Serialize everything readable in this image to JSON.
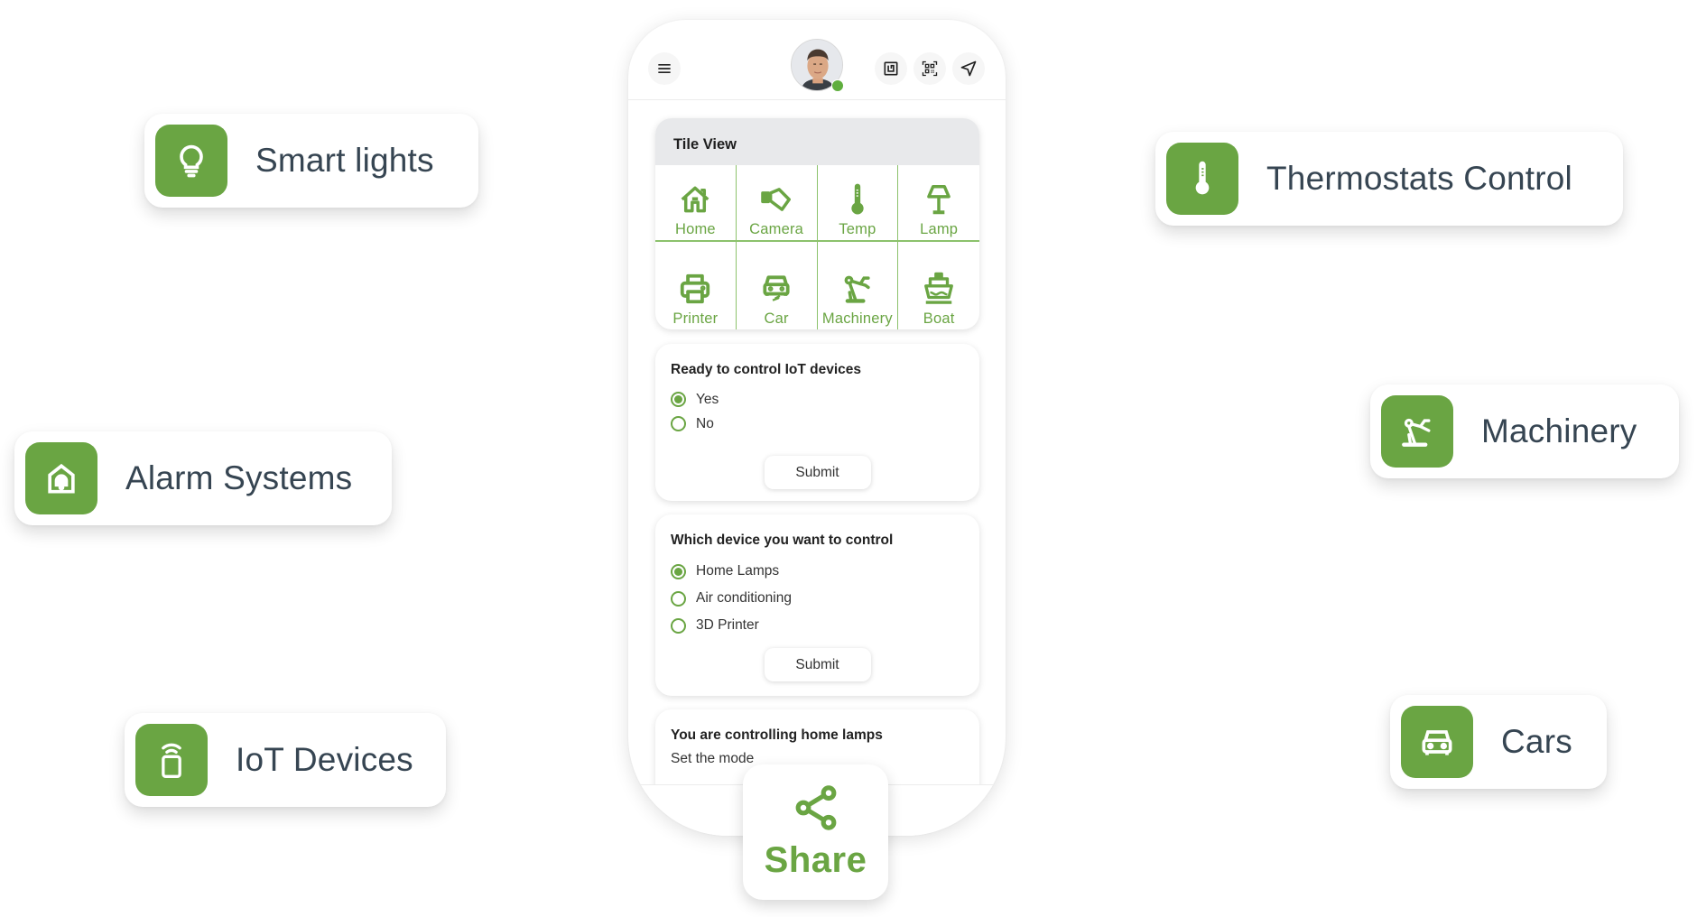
{
  "theme": {
    "accent": "#6aa543",
    "label_color": "#364552",
    "online": "#5fae3e"
  },
  "features": [
    {
      "label": "Smart lights",
      "icon": "lightbulb-icon"
    },
    {
      "label": "Thermostats Control",
      "icon": "thermometer-icon"
    },
    {
      "label": "Alarm Systems",
      "icon": "home-alarm-icon"
    },
    {
      "label": "IoT Devices",
      "icon": "remote-signal-icon"
    },
    {
      "label": "Machinery",
      "icon": "robot-arm-icon"
    },
    {
      "label": "Cars",
      "icon": "car-icon"
    }
  ],
  "header": {
    "menu_icon": "hamburger-menu-icon",
    "avatar": "user-avatar",
    "status": "online",
    "actions": [
      "nfc-icon",
      "qr-code-icon",
      "send-icon"
    ]
  },
  "tile_view": {
    "title": "Tile View",
    "tiles": [
      {
        "label": "Home",
        "icon": "home-icon"
      },
      {
        "label": "Camera",
        "icon": "camera-icon"
      },
      {
        "label": "Temp",
        "icon": "thermometer-icon"
      },
      {
        "label": "Lamp",
        "icon": "lamp-icon"
      },
      {
        "label": "Printer",
        "icon": "printer-icon"
      },
      {
        "label": "Car",
        "icon": "electric-car-icon"
      },
      {
        "label": "Machinery",
        "icon": "robot-arm-icon"
      },
      {
        "label": "Boat",
        "icon": "boat-icon"
      }
    ]
  },
  "question1": {
    "title": "Ready to control IoT devices",
    "options": [
      {
        "label": "Yes",
        "selected": true
      },
      {
        "label": "No",
        "selected": false
      }
    ],
    "submit_label": "Submit"
  },
  "question2": {
    "title": "Which device you want to control",
    "options": [
      {
        "label": "Home Lamps",
        "selected": true
      },
      {
        "label": "Air conditioning",
        "selected": false
      },
      {
        "label": "3D Printer",
        "selected": false
      }
    ],
    "submit_label": "Submit"
  },
  "status_card": {
    "title": "You are controlling home lamps",
    "subtitle": "Set the mode"
  },
  "share": {
    "label": "Share",
    "icon": "share-icon"
  }
}
